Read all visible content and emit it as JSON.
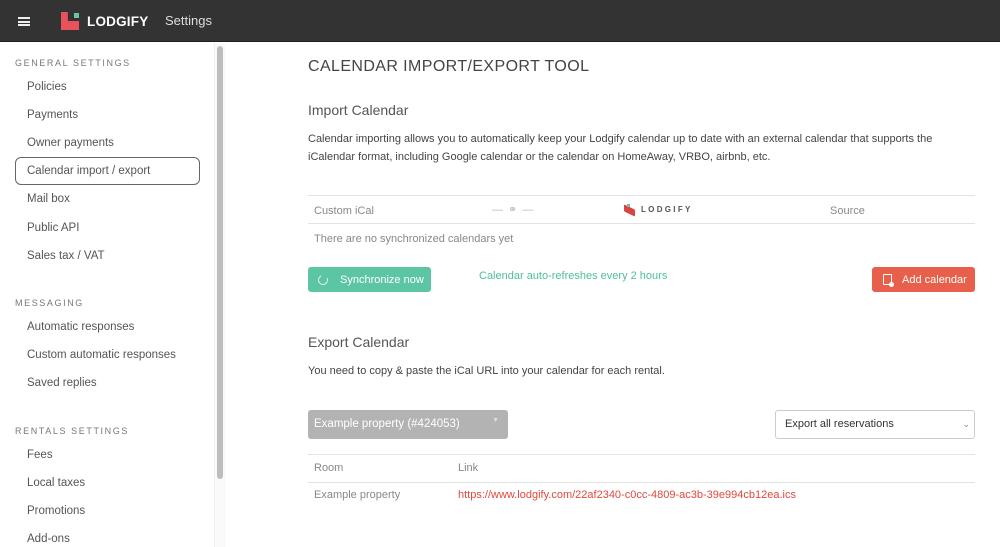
{
  "topbar": {
    "brand": "LODGIFY",
    "section": "Settings",
    "colors": {
      "background": "#333333",
      "logo_red": "#e9515c",
      "logo_green": "#6cc4a8"
    }
  },
  "sidebar": {
    "sections": [
      {
        "title": "GENERAL SETTINGS",
        "items": [
          "Policies",
          "Payments",
          "Owner payments",
          "Calendar import / export",
          "Mail box",
          "Public API",
          "Sales tax / VAT"
        ]
      },
      {
        "title": "MESSAGING",
        "items": [
          "Automatic responses",
          "Custom automatic responses",
          "Saved replies"
        ]
      },
      {
        "title": "RENTALS SETTINGS",
        "items": [
          "Fees",
          "Local taxes",
          "Promotions",
          "Add-ons"
        ]
      }
    ],
    "active_item": "Calendar import / export"
  },
  "main": {
    "title": "CALENDAR IMPORT/EXPORT TOOL",
    "import": {
      "heading": "Import Calendar",
      "description": "Calendar importing allows you to automatically keep your Lodgify calendar up to date with an external calendar that supports the iCalendar format, including Google calendar or the calendar on HomeAway, VRBO, airbnb, etc.",
      "table": {
        "col_custom": "Custom iCal",
        "link_icon": "— ⚭ —",
        "col_lodgify": "LODGIFY",
        "col_source": "Source",
        "empty": "There are no synchronized calendars yet"
      },
      "sync_button": "Synchronize now",
      "auto_refresh": "Calendar auto-refreshes every 2 hours",
      "add_button": "Add calendar",
      "colors": {
        "sync": "#5cc6a4",
        "add": "#e8604c",
        "refresh_text": "#4fbf98"
      }
    },
    "export": {
      "heading": "Export Calendar",
      "description": "You need to copy & paste the iCal URL into your calendar for each rental.",
      "property_select": "Example property (#424053)",
      "export_select": "Export all reservations",
      "table": {
        "headers": [
          "Room",
          "Link"
        ],
        "rows": [
          {
            "room": "Example property",
            "link": "https://www.lodgify.com/22af2340-c0cc-4809-ac3b-39e994cb12ea.ics"
          }
        ]
      },
      "link_color": "#e2483d"
    }
  }
}
